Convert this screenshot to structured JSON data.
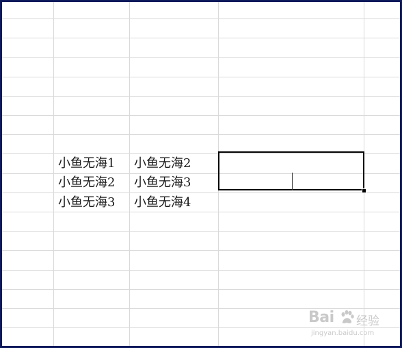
{
  "sheet": {
    "rows": [
      {
        "b": "小鱼无海1",
        "c": "小鱼无海2"
      },
      {
        "b": "小鱼无海2",
        "c": "小鱼无海3"
      },
      {
        "b": "小鱼无海3",
        "c": "小鱼无海4"
      }
    ]
  },
  "watermark": {
    "logo_text": "Bai",
    "logo_text2": "经验",
    "url": "jingyan.baidu.com"
  },
  "colors": {
    "frame": "#0d1a5c",
    "gridline": "#d9d9d9",
    "selection": "#000000"
  }
}
